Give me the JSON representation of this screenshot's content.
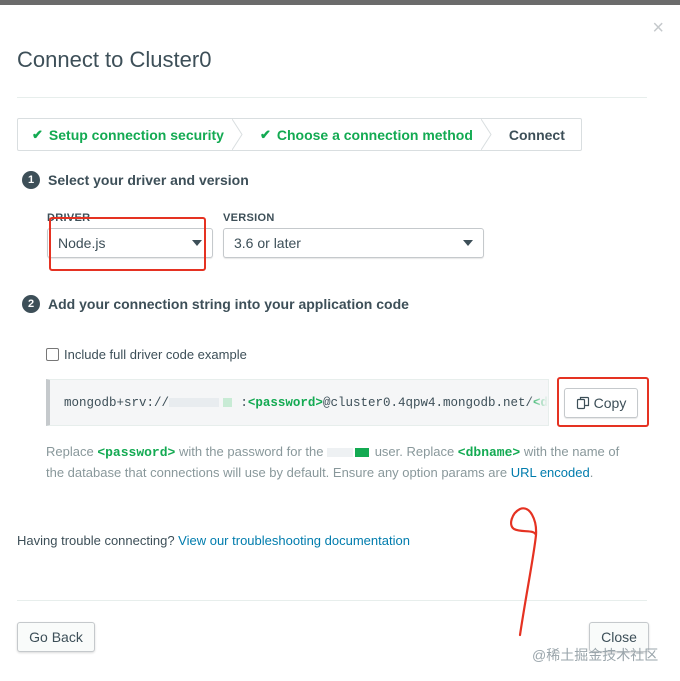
{
  "modal": {
    "title": "Connect to Cluster0",
    "close_glyph": "×"
  },
  "breadcrumb": {
    "steps": [
      {
        "label": "Setup connection security",
        "status": "done"
      },
      {
        "label": "Choose a connection method",
        "status": "done"
      },
      {
        "label": "Connect",
        "status": "current"
      }
    ],
    "check_glyph": "✔"
  },
  "step1": {
    "number": "1",
    "title": "Select your driver and version",
    "driver_label": "DRIVER",
    "driver_value": "Node.js",
    "version_label": "VERSION",
    "version_value": "3.6 or later"
  },
  "step2": {
    "number": "2",
    "title": "Add your connection string into your application code",
    "checkbox_label": "Include full driver code example",
    "checkbox_checked": false,
    "conn_prefix": "mongodb+srv://",
    "conn_sep": ":",
    "conn_password": "<password>",
    "conn_host": "@cluster0.4qpw4.mongodb.net/",
    "conn_dbname": "<d",
    "copy_label": "Copy"
  },
  "description": {
    "t1": "Replace ",
    "password": "<password>",
    "t2": " with the password for the ",
    "t3": " user. Replace ",
    "dbname": "<dbname>",
    "t4": " with the name of the database that connections will use by default. Ensure any option params are ",
    "link": "URL encoded",
    "t5": "."
  },
  "help": {
    "text": "Having trouble connecting? ",
    "link": "View our troubleshooting documentation"
  },
  "footer": {
    "back_label": "Go Back",
    "close_label": "Close"
  },
  "watermark": "@稀土掘金技术社区",
  "colors": {
    "green": "#13aa52",
    "text": "#3d4f58",
    "link": "#007cad",
    "annotation_red": "#e53222"
  }
}
